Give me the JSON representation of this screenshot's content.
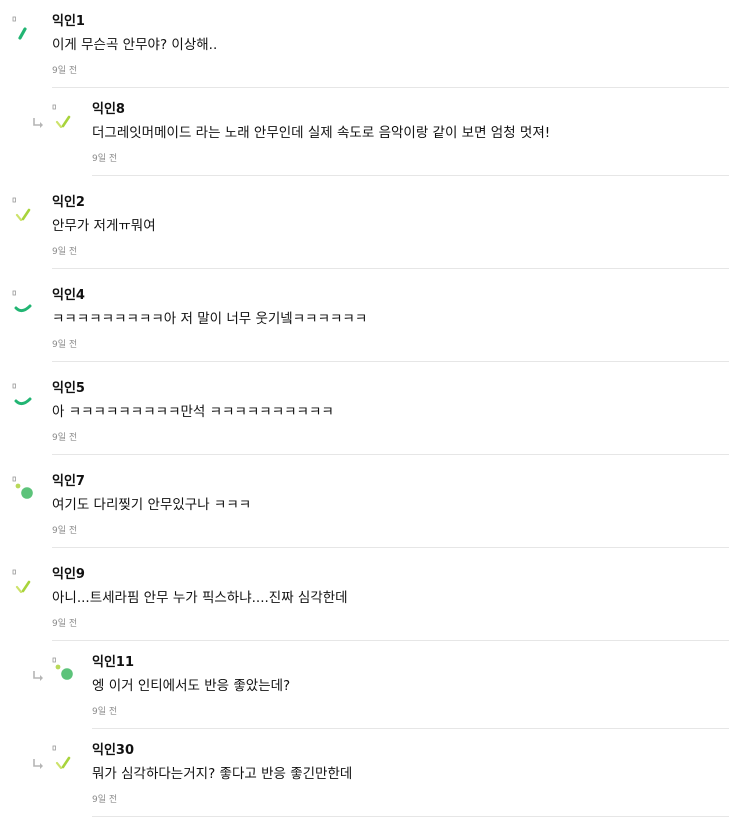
{
  "comments": [
    {
      "author": "익인1",
      "text": "이게 무슨곡 안무야? 이상해..",
      "time": "9일 전",
      "avatar": "dash-green",
      "reply": false
    },
    {
      "author": "익인8",
      "text": "더그레잇머메이드 라는 노래 안무인데 실제 속도로 음악이랑 같이 보면 엄청 멋져!",
      "time": "9일 전",
      "avatar": "slash-lime",
      "reply": true
    },
    {
      "author": "익인2",
      "text": "안무가 저게ㅠ뭐여",
      "time": "9일 전",
      "avatar": "slash-lime",
      "reply": false
    },
    {
      "author": "익인4",
      "text": "ㅋㅋㅋㅋㅋㅋㅋㅋㅋ아 저 말이 너무 웃기넼ㅋㅋㅋㅋㅋㅋ",
      "time": "9일 전",
      "avatar": "arc-green",
      "reply": false
    },
    {
      "author": "익인5",
      "text": "아 ㅋㅋㅋㅋㅋㅋㅋㅋㅋ만석 ㅋㅋㅋㅋㅋㅋㅋㅋㅋㅋ",
      "time": "9일 전",
      "avatar": "arc-green",
      "reply": false
    },
    {
      "author": "익인7",
      "text": "여기도 다리찢기 안무있구나 ㅋㅋㅋ",
      "time": "9일 전",
      "avatar": "dots-green",
      "reply": false
    },
    {
      "author": "익인9",
      "text": "아니...트세라핌 안무 누가 픽스하냐....진짜 심각한데",
      "time": "9일 전",
      "avatar": "slash-lime",
      "reply": false
    },
    {
      "author": "익인11",
      "text": "엥 이거 인티에서도 반응 좋았는데?",
      "time": "9일 전",
      "avatar": "dots-green",
      "reply": true
    },
    {
      "author": "익인30",
      "text": "뭐가 심각하다는거지? 좋다고 반응 좋긴만한데",
      "time": "9일 전",
      "avatar": "slash-lime",
      "reply": true
    }
  ],
  "colors": {
    "green": "#22b573",
    "lime": "#a8d43c",
    "dot": "#5cc37a"
  }
}
